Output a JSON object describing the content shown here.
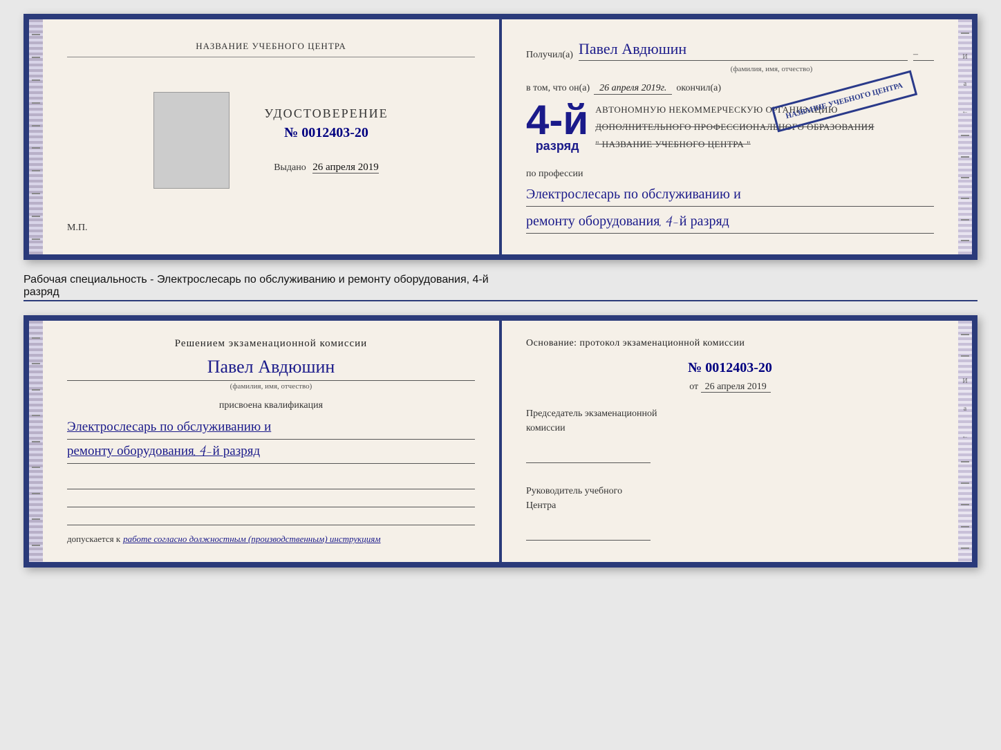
{
  "topBooklet": {
    "left": {
      "orgNameTop": "НАЗВАНИЕ УЧЕБНОГО ЦЕНТРА",
      "certTitle": "УДОСТОВЕРЕНИЕ",
      "certNumber": "№ 0012403-20",
      "issuedLabel": "Выдано",
      "issuedDate": "26 апреля 2019",
      "mpLabel": "М.П."
    },
    "right": {
      "receivedLabel": "Получил(а)",
      "receivedName": "Павел Авдюшин",
      "fioLabel": "(фамилия, имя, отчество)",
      "vtomLabel": "в том, что он(а)",
      "vtomDate": "26 апреля 2019г.",
      "okonchilLabel": "окончил(а)",
      "orgLine1": "АВТОНОМНУЮ НЕКОММЕРЧЕСКУЮ ОРГАНИЗАЦИЮ",
      "orgLine2": "ДОПОЛНИТЕЛЬНОГО ПРОФЕССИОНАЛЬНОГО ОБРАЗОВАНИЯ",
      "orgLine3": "\" НАЗВАНИЕ УЧЕБНОГО ЦЕНТРА \"",
      "poProfessiiLabel": "по профессии",
      "professionLine1": "Электрослесарь по обслуживанию и",
      "professionLine2": "ремонту оборудования, 4-й разряд",
      "stampLine1": "4-й",
      "stampLine2": "разряд"
    }
  },
  "specialtyText": "Рабочая специальность - Электрослесарь по обслуживанию и ремонту оборудования, 4-й",
  "specialtyText2": "разряд",
  "bottomBooklet": {
    "left": {
      "decisionTitle": "Решением экзаменационной комиссии",
      "personName": "Павел Авдюшин",
      "fioLabel": "(фамилия, имя, отчество)",
      "prisvoenaLabel": "присвоена квалификация",
      "qualLine1": "Электрослесарь по обслуживанию и",
      "qualLine2": "ремонту оборудования, 4-й разряд",
      "dopuskaetsyaLabel": "допускается к",
      "dopuskaetsyaValue": "работе согласно должностным (производственным) инструкциям"
    },
    "right": {
      "osnovanieTitleLine1": "Основание: протокол экзаменационной комиссии",
      "protocolNumber": "№ 0012403-20",
      "otLabel": "от",
      "otDate": "26 апреля 2019",
      "predsedatelTitle": "Председатель экзаменационной",
      "predsedatelTitle2": "комиссии",
      "rukovoditelTitle": "Руководитель учебного",
      "rukovoditelTitle2": "Центра"
    }
  },
  "sideDecorations": {
    "dashCount": 10,
    "letters": [
      "И",
      "а",
      "←",
      "–",
      "–",
      "–",
      "–"
    ]
  }
}
